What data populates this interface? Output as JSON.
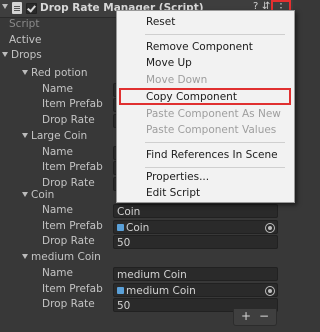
{
  "header": {
    "title": "Drop Rate Manager (Script)",
    "help_icon": "help-icon",
    "preset_icon": "preset-icon",
    "menu_icon": "kebab-menu-icon",
    "menu_glyph": "⋮"
  },
  "props": {
    "script_label": "Script",
    "active_label": "Active",
    "drops_label": "Drops"
  },
  "drops": [
    {
      "name": "Red potion",
      "name_label": "Name",
      "prefab_label": "Item Prefab",
      "rate_label": "Drop Rate",
      "name_value": "",
      "prefab_value": "",
      "rate_value": ""
    },
    {
      "name": "Large Coin",
      "name_label": "Name",
      "prefab_label": "Item Prefab",
      "rate_label": "Drop Rate",
      "name_value": "",
      "prefab_value": "",
      "rate_value": ""
    },
    {
      "name": "Coin",
      "name_label": "Name",
      "prefab_label": "Item Prefab",
      "rate_label": "Drop Rate",
      "name_value": "Coin",
      "prefab_value": "Coin",
      "rate_value": "50"
    },
    {
      "name": "medium Coin",
      "name_label": "Name",
      "prefab_label": "Item Prefab",
      "rate_label": "Drop Rate",
      "name_value": "medium Coin",
      "prefab_value": "medium Coin",
      "rate_value": "50"
    }
  ],
  "footer": {
    "add": "+",
    "remove": "−"
  },
  "context_menu": {
    "reset": "Reset",
    "remove_component": "Remove Component",
    "move_up": "Move Up",
    "move_down": "Move Down",
    "copy_component": "Copy Component",
    "paste_as_new": "Paste Component As New",
    "paste_values": "Paste Component Values",
    "find_references": "Find References In Scene",
    "properties": "Properties...",
    "edit_script": "Edit Script"
  },
  "colors": {
    "background": "#383838",
    "menu_background": "#f2f2f2",
    "highlight": "#e03030"
  }
}
